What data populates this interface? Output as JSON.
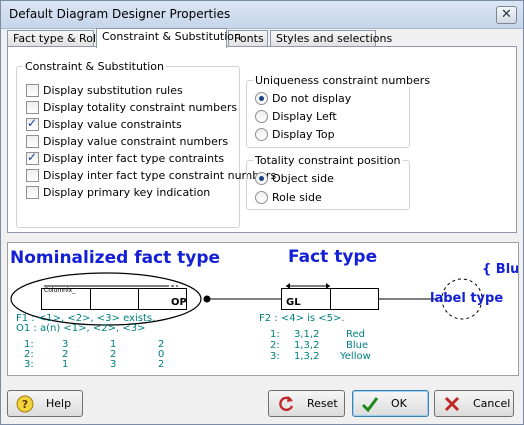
{
  "window": {
    "title": "Default Diagram Designer Properties",
    "close_glyph": "✕"
  },
  "tabs": [
    {
      "label": "Fact type & Role"
    },
    {
      "label": "Constraint & Substitution",
      "active": true
    },
    {
      "label": "Fonts"
    },
    {
      "label": "Styles and selections"
    }
  ],
  "constraint_group": {
    "title": "Constraint & Substitution",
    "options": [
      {
        "label": "Display substitution rules",
        "checked": false
      },
      {
        "label": "Display totality constraint numbers",
        "checked": false
      },
      {
        "label": "Display value constraints",
        "checked": true
      },
      {
        "label": "Display value constraint numbers",
        "checked": false
      },
      {
        "label": "Display inter fact type contraints",
        "checked": true
      },
      {
        "label": "Display inter fact type constraint numbers",
        "checked": false
      },
      {
        "label": "Display primary key indication",
        "checked": false
      }
    ]
  },
  "uniqueness_group": {
    "title": "Uniqueness constraint numbers",
    "options": [
      {
        "label": "Do not display",
        "selected": true
      },
      {
        "label": "Display Left",
        "selected": false
      },
      {
        "label": "Display Top",
        "selected": false
      }
    ]
  },
  "totality_group": {
    "title": "Totality constraint position",
    "options": [
      {
        "label": "Object side",
        "selected": true
      },
      {
        "label": "Role side",
        "selected": false
      }
    ]
  },
  "preview": {
    "nominalized_title": "Nominalized fact type",
    "fact_title": "Fact type",
    "blue_brace_text": "{ Blu",
    "label_type_text": "label type",
    "column_text": "Columnix_",
    "op_text": "OP",
    "gl_text": "GL",
    "f1_text": "F1 : <1>, <2>, <3> exists.",
    "o1_text": "O1 : a(n) <1>, <2>, <3>",
    "f2_text": "F2 : <4> is <5>.",
    "left_rows": [
      [
        "1:",
        "3",
        "1",
        "2"
      ],
      [
        "2:",
        "2",
        "2",
        "0"
      ],
      [
        "3:",
        "1",
        "3",
        "2"
      ]
    ],
    "right_rows": [
      [
        "1:",
        "3,1,2",
        "Red"
      ],
      [
        "2:",
        "1,3,2",
        "Blue"
      ],
      [
        "3:",
        "1,3,2",
        "Yellow"
      ]
    ]
  },
  "buttons": {
    "help": "Help",
    "reset": "Reset",
    "ok": "OK",
    "cancel": "Cancel"
  },
  "colors": {
    "preview_blue": "#1420d6",
    "preview_teal": "#007f7f"
  }
}
